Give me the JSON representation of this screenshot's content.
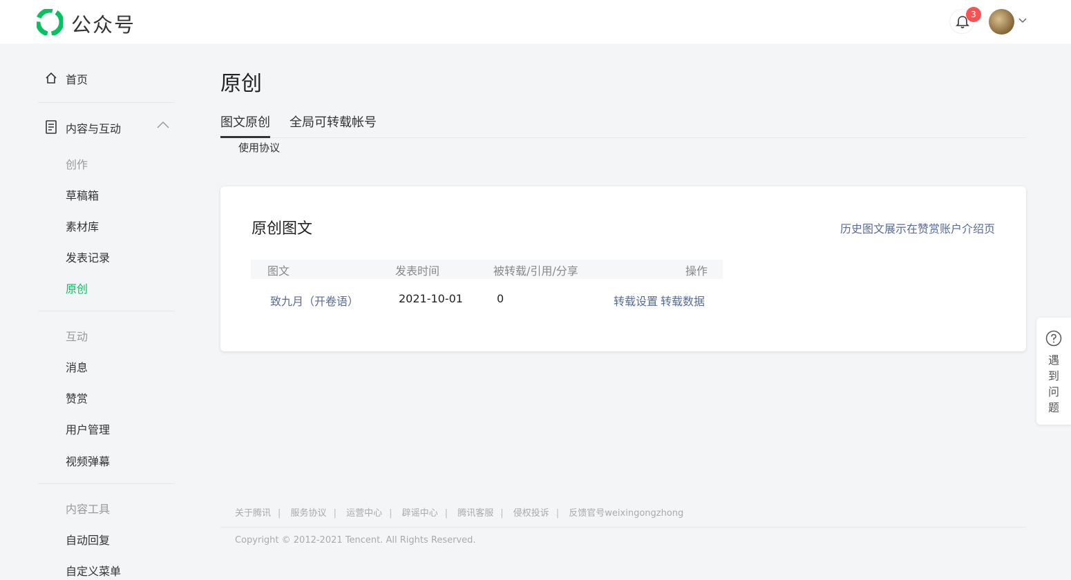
{
  "header": {
    "brand": "公众号",
    "notification_count": "3"
  },
  "sidebar": {
    "home": "首页",
    "content_section": "内容与互动",
    "groups": {
      "create": "创作",
      "interact": "互动",
      "tools": "内容工具"
    },
    "items": {
      "drafts": "草稿箱",
      "library": "素材库",
      "publish_records": "发表记录",
      "original": "原创",
      "messages": "消息",
      "appreciation": "赞赏",
      "user_management": "用户管理",
      "video_danmaku": "视频弹幕",
      "auto_reply": "自动回复",
      "custom_menu": "自定义菜单"
    }
  },
  "main": {
    "title": "原创",
    "tabs": [
      "图文原创",
      "全局可转载帐号"
    ],
    "usage_link": "使用协议",
    "card": {
      "title": "原创图文",
      "link": "历史图文展示在赞赏账户介绍页",
      "columns": [
        "图文",
        "发表时间",
        "被转载/引用/分享",
        "操作"
      ],
      "rows": [
        {
          "title": "致九月（开卷语）",
          "date": "2021-10-01",
          "count": "0",
          "action_settings": "转载设置",
          "action_data": "转载数据"
        }
      ]
    }
  },
  "help": {
    "text": "遇到问题"
  },
  "footer": {
    "links": [
      "关于腾讯",
      "服务协议",
      "运营中心",
      "辟谣中心",
      "腾讯客服",
      "侵权投诉",
      "反馈官号weixingongzhong"
    ],
    "copyright": "Copyright © 2012-2021 Tencent. All Rights Reserved."
  },
  "colors": {
    "accent_green": "#07c160",
    "link_blue": "#576b95",
    "badge_red": "#fa5151"
  }
}
